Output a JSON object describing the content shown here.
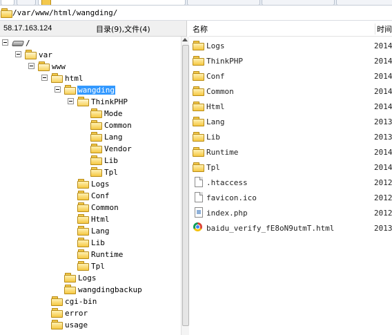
{
  "path": {
    "value": "/var/www/html/wangding/"
  },
  "left_header": {
    "ip": "58.17.163.124",
    "dir_count": "目录(9),文件(4)"
  },
  "right_header": {
    "name": "名称",
    "time": "时间"
  },
  "tree": [
    {
      "label": "/",
      "depth": 0,
      "icon": "drive",
      "expanded": true,
      "selected": false
    },
    {
      "label": "var",
      "depth": 1,
      "icon": "folder-open",
      "expanded": true,
      "selected": false
    },
    {
      "label": "www",
      "depth": 2,
      "icon": "folder-open",
      "expanded": true,
      "selected": false
    },
    {
      "label": "html",
      "depth": 3,
      "icon": "folder-open",
      "expanded": true,
      "selected": false
    },
    {
      "label": "wangding",
      "depth": 4,
      "icon": "folder-open",
      "expanded": true,
      "selected": true
    },
    {
      "label": "ThinkPHP",
      "depth": 5,
      "icon": "folder-open",
      "expanded": true,
      "selected": false
    },
    {
      "label": "Mode",
      "depth": 6,
      "icon": "folder",
      "expanded": false,
      "selected": false
    },
    {
      "label": "Common",
      "depth": 6,
      "icon": "folder",
      "expanded": false,
      "selected": false
    },
    {
      "label": "Lang",
      "depth": 6,
      "icon": "folder",
      "expanded": false,
      "selected": false
    },
    {
      "label": "Vendor",
      "depth": 6,
      "icon": "folder",
      "expanded": false,
      "selected": false
    },
    {
      "label": "Lib",
      "depth": 6,
      "icon": "folder",
      "expanded": false,
      "selected": false
    },
    {
      "label": "Tpl",
      "depth": 6,
      "icon": "folder",
      "expanded": false,
      "selected": false
    },
    {
      "label": "Logs",
      "depth": 5,
      "icon": "folder",
      "expanded": false,
      "selected": false
    },
    {
      "label": "Conf",
      "depth": 5,
      "icon": "folder",
      "expanded": false,
      "selected": false
    },
    {
      "label": "Common",
      "depth": 5,
      "icon": "folder",
      "expanded": false,
      "selected": false
    },
    {
      "label": "Html",
      "depth": 5,
      "icon": "folder",
      "expanded": false,
      "selected": false
    },
    {
      "label": "Lang",
      "depth": 5,
      "icon": "folder",
      "expanded": false,
      "selected": false
    },
    {
      "label": "Lib",
      "depth": 5,
      "icon": "folder",
      "expanded": false,
      "selected": false
    },
    {
      "label": "Runtime",
      "depth": 5,
      "icon": "folder",
      "expanded": false,
      "selected": false
    },
    {
      "label": "Tpl",
      "depth": 5,
      "icon": "folder",
      "expanded": false,
      "selected": false
    },
    {
      "label": "Logs",
      "depth": 4,
      "icon": "folder",
      "expanded": false,
      "selected": false
    },
    {
      "label": "wangdingbackup",
      "depth": 4,
      "icon": "folder",
      "expanded": false,
      "selected": false
    },
    {
      "label": "cgi-bin",
      "depth": 3,
      "icon": "folder",
      "expanded": false,
      "selected": false
    },
    {
      "label": "error",
      "depth": 3,
      "icon": "folder",
      "expanded": false,
      "selected": false
    },
    {
      "label": "usage",
      "depth": 3,
      "icon": "folder",
      "expanded": false,
      "selected": false
    }
  ],
  "files": [
    {
      "name": "Logs",
      "type": "folder",
      "time": "2014"
    },
    {
      "name": "ThinkPHP",
      "type": "folder",
      "time": "2014"
    },
    {
      "name": "Conf",
      "type": "folder",
      "time": "2014"
    },
    {
      "name": "Common",
      "type": "folder",
      "time": "2014"
    },
    {
      "name": "Html",
      "type": "folder",
      "time": "2014"
    },
    {
      "name": "Lang",
      "type": "folder",
      "time": "2013"
    },
    {
      "name": "Lib",
      "type": "folder",
      "time": "2013"
    },
    {
      "name": "Runtime",
      "type": "folder",
      "time": "2014"
    },
    {
      "name": "Tpl",
      "type": "folder",
      "time": "2014"
    },
    {
      "name": ".htaccess",
      "type": "file",
      "time": "2012"
    },
    {
      "name": "favicon.ico",
      "type": "file",
      "time": "2012"
    },
    {
      "name": "index.php",
      "type": "php",
      "time": "2012"
    },
    {
      "name": "baidu_verify_fE8oN9utmT.html",
      "type": "html",
      "time": "2013"
    }
  ],
  "colors": {
    "selection": "#3399ff",
    "folder": "#f5c842"
  }
}
